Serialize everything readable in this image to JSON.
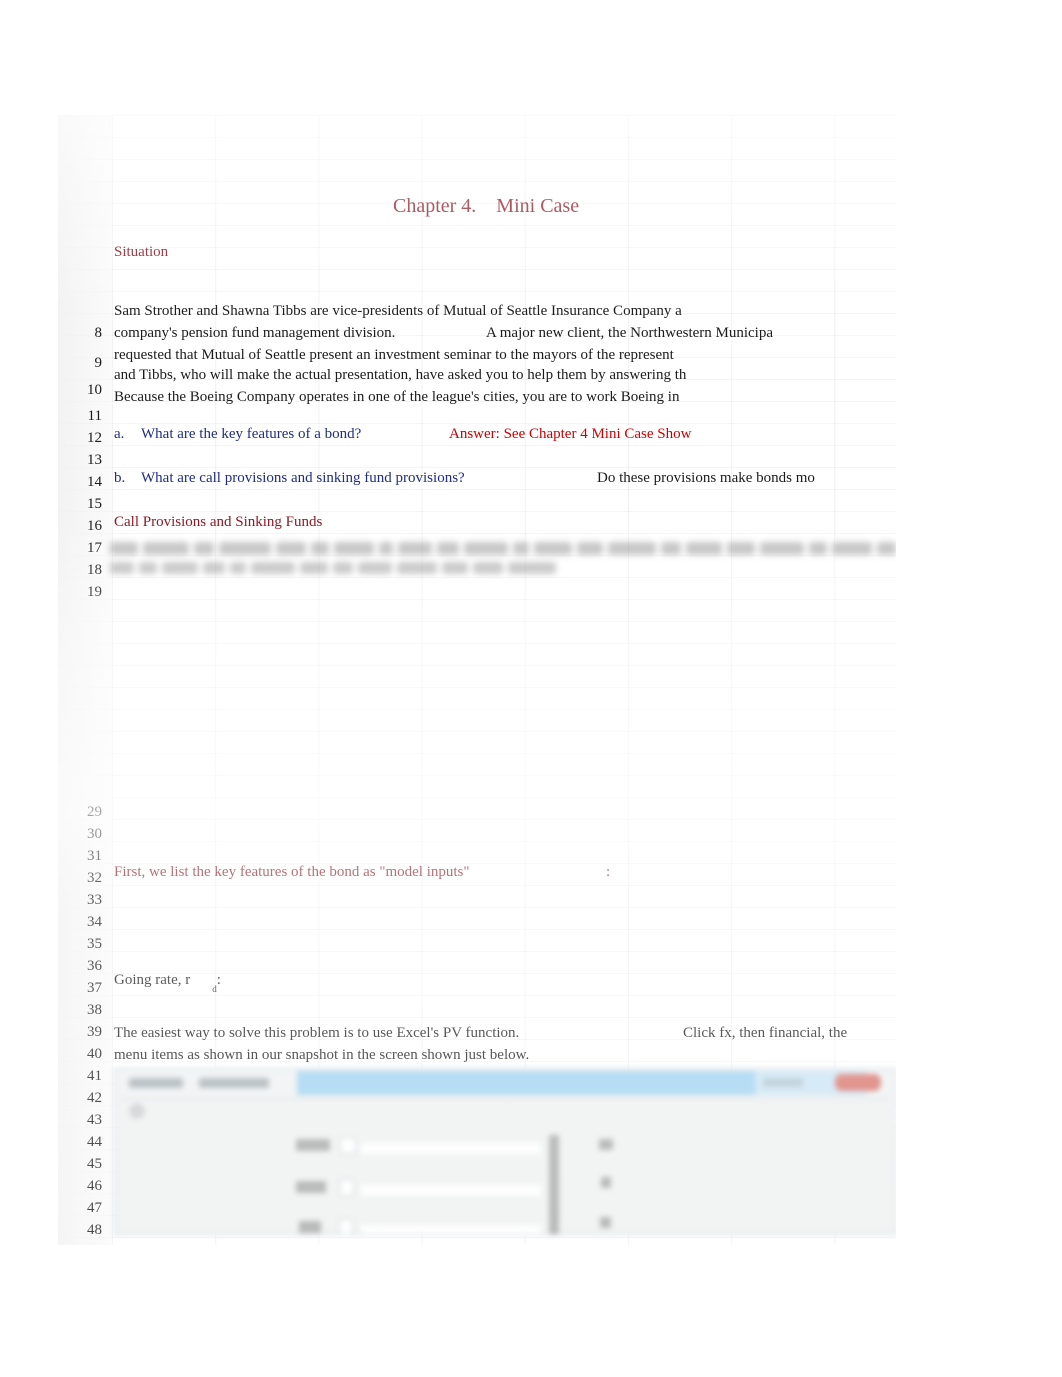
{
  "document": {
    "title": "Chapter 4.    Mini Case",
    "section_heading": "Situation"
  },
  "rows": {
    "numbers_top": [
      "8",
      "9",
      "10",
      "11",
      "12",
      "13",
      "14",
      "15",
      "16",
      "17",
      "18",
      "19"
    ],
    "numbers_bottom": [
      "29",
      "30",
      "31",
      "32",
      "33",
      "34",
      "35",
      "36",
      "37",
      "38",
      "39",
      "40",
      "41",
      "42",
      "43",
      "44",
      "45",
      "46",
      "47",
      "48"
    ]
  },
  "situation": {
    "line1": "Sam Strother and Shawna Tibbs are vice-presidents of Mutual of Seattle Insurance Company a",
    "line2a": "company's pension fund management division.",
    "line2b": "A major new client, the Northwestern Municipa",
    "line3": "requested that Mutual of Seattle present an investment seminar to the mayors of the represent",
    "line4": "and Tibbs, who will make the actual presentation, have asked you to help them by answering th",
    "line5": "Because the Boeing Company operates in one of the league's cities, you are to work Boeing in"
  },
  "questions": {
    "a_label": "a.",
    "a_text": "What are the key features of a bond?",
    "a_answer": "Answer: See Chapter 4 Mini Case Show",
    "b_label": "b.",
    "b_text": "What are call provisions and sinking fund provisions?",
    "b_text2": "Do these provisions make bonds mo"
  },
  "subheadings": {
    "call_provisions": "Call Provisions and Sinking Funds",
    "model_inputs": "First, we list the key features of the bond as \"model inputs\"",
    "model_inputs_colon": ":"
  },
  "inputs": {
    "going_rate_label": "Going rate, r",
    "going_rate_sub": "d",
    "going_rate_colon": ":"
  },
  "pv_note": {
    "line1a": "The easiest way to solve this problem is to use Excel's PV function.",
    "line1b": "Click fx, then financial, the",
    "line2": "menu items as shown in our snapshot in the screen shown just below."
  },
  "colors": {
    "accent_dark_red": "#8c1420",
    "question_blue": "#1f2d86",
    "answer_red": "#cc0000",
    "body_black": "#1c1c1c",
    "dialog_title_blue": "#9ed2f0",
    "dialog_close_red": "#d9736b"
  }
}
